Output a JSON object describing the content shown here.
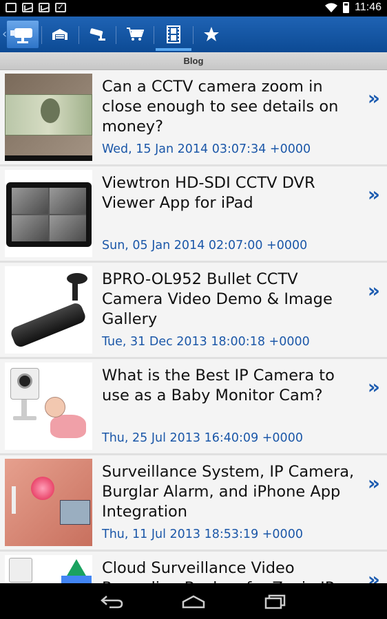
{
  "status_bar": {
    "time": "11:46",
    "left_icons": [
      "image-icon",
      "mail-icon",
      "mail-icon",
      "clipboard-check-icon"
    ],
    "right_icons": [
      "wifi-icon",
      "battery-icon"
    ]
  },
  "toolbar": {
    "back_glyph": "‹",
    "tabs": [
      {
        "name": "cctv-camera-logo-icon",
        "selected": false
      },
      {
        "name": "garage-icon",
        "selected": false
      },
      {
        "name": "security-camera-icon",
        "selected": false
      },
      {
        "name": "shopping-cart-icon",
        "selected": false
      },
      {
        "name": "film-strip-icon",
        "selected": true
      },
      {
        "name": "star-icon",
        "selected": false
      }
    ],
    "accent_color": "#0c4a94"
  },
  "section": {
    "title": "Blog"
  },
  "posts": [
    {
      "title": "Can a CCTV camera zoom in close enough to see details on money?",
      "date": "Wed, 15 Jan 2014 03:07:34 +0000",
      "thumb": "money-zoom-thumbnail"
    },
    {
      "title": "Viewtron HD-SDI CCTV DVR Viewer App for iPad",
      "date": "Sun, 05 Jan 2014 02:07:00 +0000",
      "thumb": "ipad-dvr-thumbnail"
    },
    {
      "title": "BPRO-OL952 Bullet CCTV Camera Video Demo & Image Gallery",
      "date": "Tue, 31 Dec 2013 18:00:18 +0000",
      "thumb": "bullet-camera-thumbnail"
    },
    {
      "title": "What is the Best IP Camera to use as a Baby Monitor Cam?",
      "date": "Thu, 25 Jul 2013 16:40:09 +0000",
      "thumb": "baby-monitor-thumbnail"
    },
    {
      "title": "Surveillance System, IP Camera, Burglar Alarm, and iPhone App Integration",
      "date": "Thu, 11 Jul 2013 18:53:19 +0000",
      "thumb": "alarm-integration-thumbnail"
    },
    {
      "title": "Cloud Surveillance Video Recording Backup for Zavio IP",
      "date": "",
      "thumb": "cloud-drive-thumbnail"
    }
  ],
  "chevron_glyph": "»",
  "link_color": "#1b57a8"
}
